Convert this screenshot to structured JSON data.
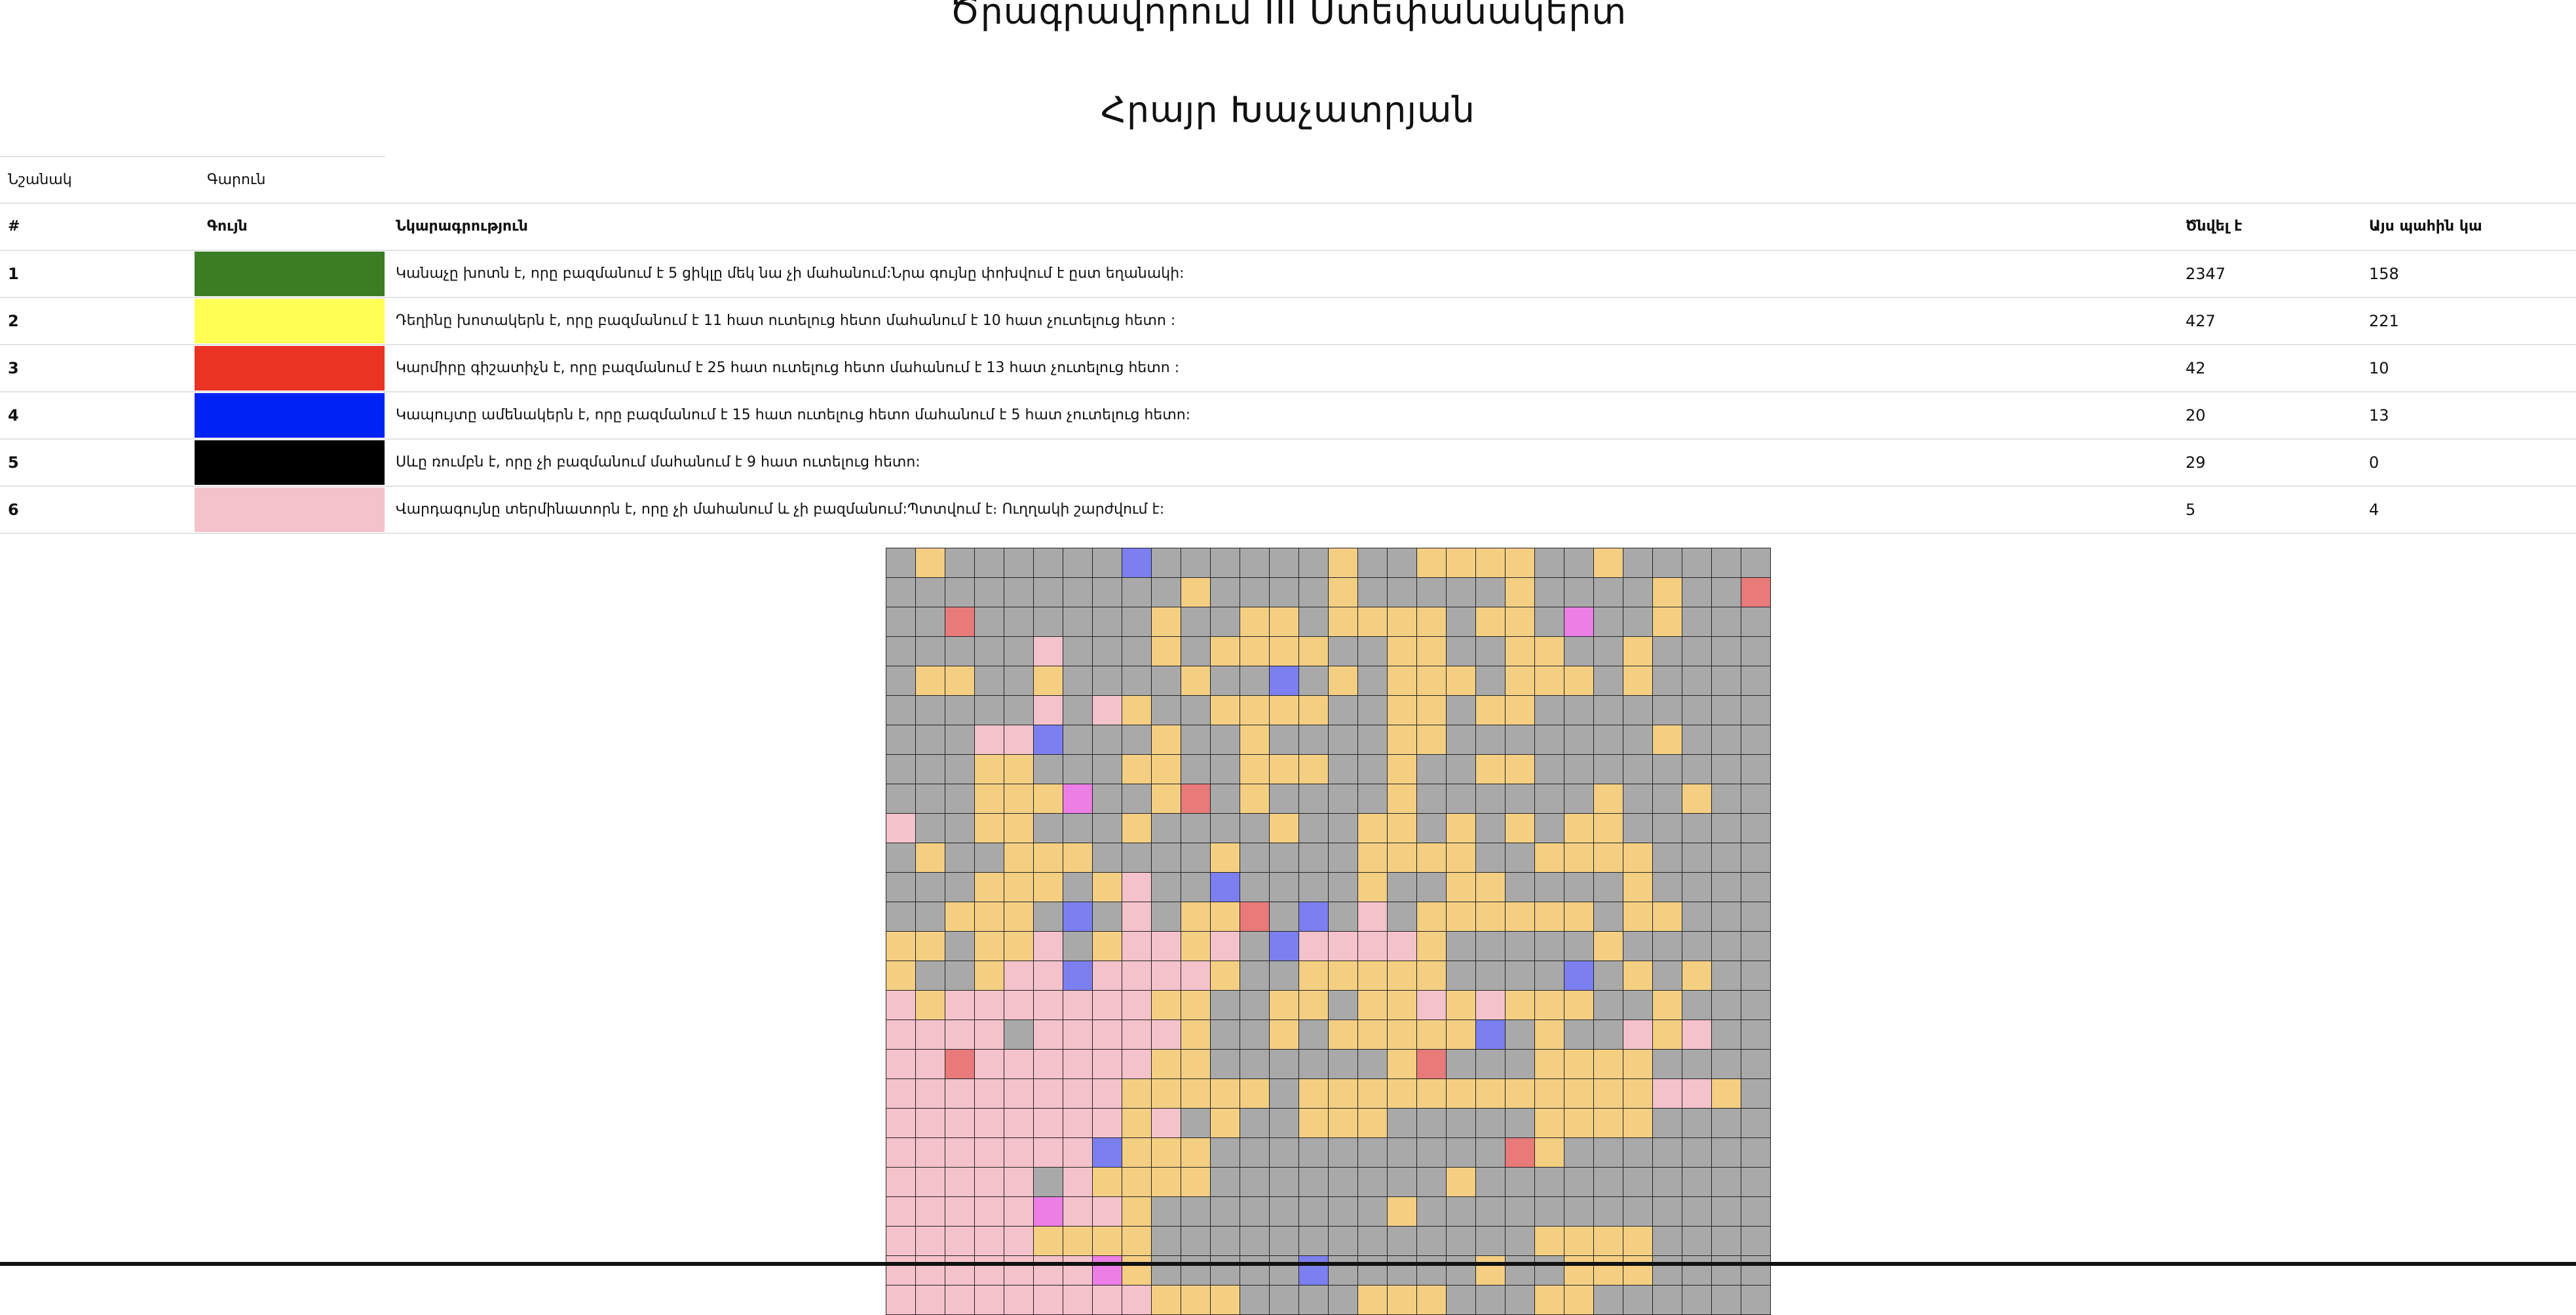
{
  "header": {
    "title": "Ծրագրավորում III Ստեփանակերտ",
    "subtitle": "Հրայր Խաչատրյան"
  },
  "top_row": {
    "col1": "Նշանակ",
    "col2": "Գարուն"
  },
  "table": {
    "headers": {
      "num": "#",
      "color": "Գույն",
      "desc": "Նկարագրություն",
      "total": "Ծնվել է",
      "avail": "Այս պահին կա"
    },
    "rows": [
      {
        "num": "1",
        "color": "#3a7d23",
        "desc": "Կանաչը խոտն է, որը բազմանում է 5 ցիկլը մեկ նա չի մահանում:Նրա գույնը փոխվում է ըստ եղանակի:",
        "total": "2347",
        "avail": "158"
      },
      {
        "num": "2",
        "color": "#ffff55",
        "desc": "Դեղինը խոտակերն է, որը բազմանում է 11 հատ ուտելուց հետո մահանում է 10 հատ չուտելուց հետո :",
        "total": "427",
        "avail": "221"
      },
      {
        "num": "3",
        "color": "#ea3323",
        "desc": "Կարմիրը գիշատիչն է, որը բազմանում է 25 հատ ուտելուց հետո մահանում է 13 հատ չուտելուց հետո :",
        "total": "42",
        "avail": "10"
      },
      {
        "num": "4",
        "color": "#0023f5",
        "desc": "Կապույտը ամենակերն է, որը բազմանում է 15 հատ ուտելուց հետո մահանում է 5 հատ չուտելուց հետո:",
        "total": "20",
        "avail": "13"
      },
      {
        "num": "5",
        "color": "#000000",
        "desc": "Սևը ռումբն է, որը չի բազմանում մահանում է 9 հատ ուտելուց հետո:",
        "total": "29",
        "avail": "0"
      },
      {
        "num": "6",
        "color": "#f4c2cb",
        "desc": "Վարդագույնը տերմինատորն է, որը չի մահանում և չի բազմանում:Պտտվում է։ Ուղղակի շարժվում է:",
        "total": "5",
        "avail": "4"
      }
    ]
  },
  "matrix_colors": {
    "g": "#a9a9a9",
    "y": "#f4cf82",
    "p": "#f4c2cb",
    "b": "#7b7ff0",
    "r": "#e87a7a",
    "m": "#ec7ee6"
  },
  "matrix_rows": [
    "gyggggggbggggggyggyyyyggyggggg",
    "ggggggggggyggggygggggyggggyggrgg",
    "ggrggggggyggyygyyyygyygmggyggg",
    "gggggpgggygyyyyggyyggyyggyg",
    "gyyggyggggyggbgygyyygyyygyg",
    "gggggpgpyggyyyyggyygyyggggg",
    "gggppbgggyggyggggyygggggggy",
    "gggyygggyyggyyyggyggyygggg",
    "gggyyymggyrgyggggyggggggyggyg",
    "pggyygggyggggyggyygygygyygg",
    "gyggyyyggggyggggyyyyggyyyygg",
    "gggyyygypggbggggyggyyggggyg",
    "ggyyygbgpgyyrgbgpgyyyyyygyy",
    "yygyypgyppypgbppppygggggygg",
    "yggyppbppppyggyyyyyggggbgygy",
    "pypppppppyyggyygyypypyyyggy",
    "ppppgpppppyggygyyyyybgyggpyp",
    "pprppppppyyggggggyrgggyyyy",
    "ppppppppyyyyygyyyyyyyyyyyyppy",
    "ppppppppypgyggyyygggggyyyy",
    "pppppppbyyyggggggggggryggg",
    "pppppgpyyyyggggggggyggggggg",
    "pppppmppyggggggggyggggggggg",
    "pppppyyyygggggggggggggyyyy",
    "pppppppmygggggbgggggyggyyy",
    "pppppppppyyyggggyyygggyygg"
  ]
}
